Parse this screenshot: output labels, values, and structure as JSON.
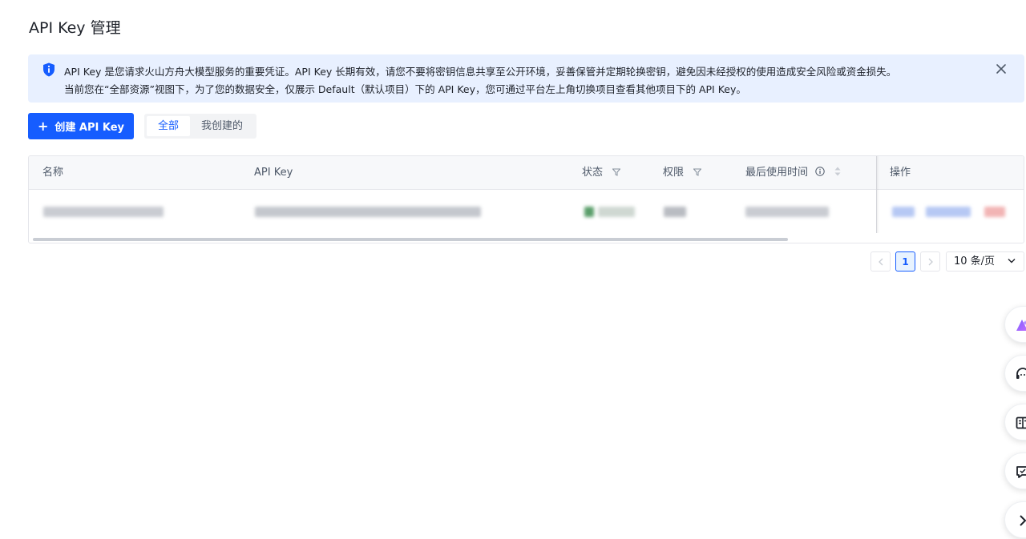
{
  "page": {
    "title": "API Key 管理"
  },
  "notice": {
    "line1": "API Key 是您请求火山方舟大模型服务的重要凭证。API Key 长期有效，请您不要将密钥信息共享至公开环境，妥善保管并定期轮换密钥，避免因未经授权的使用造成安全风险或资金损失。",
    "line2": "当前您在“全部资源”视图下，为了您的数据安全，仅展示 Default（默认项目）下的 API Key，您可通过平台左上角切换项目查看其他项目下的 API Key。"
  },
  "toolbar": {
    "create_label": "创建 API Key",
    "tabs": [
      {
        "label": "全部",
        "active": true
      },
      {
        "label": "我创建的",
        "active": false
      }
    ]
  },
  "table": {
    "columns": {
      "name": "名称",
      "api_key": "API Key",
      "status": "状态",
      "permission": "权限",
      "last_used": "最后使用时间",
      "actions": "操作"
    }
  },
  "pagination": {
    "current_page": "1",
    "page_size": "10 条/页"
  },
  "colors": {
    "accent": "#165dff",
    "notice_bg": "#e8f0ff"
  }
}
